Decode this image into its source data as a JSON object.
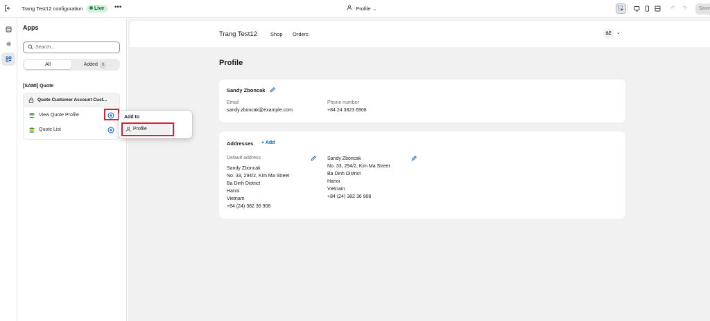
{
  "topbar": {
    "title": "Trang Test12 configuration",
    "status": "Live",
    "more": "•••",
    "page_selector": "Profile",
    "save": "Save"
  },
  "apps_panel": {
    "title": "Apps",
    "search_placeholder": "Search...",
    "tabs": {
      "all": "All",
      "added": "Added",
      "added_count": "0"
    },
    "group_title": "[SAMI] Quote",
    "app_header": "Quote Customer Account Cust...",
    "blocks": [
      {
        "label": "View Quote Profile"
      },
      {
        "label": "Quote List"
      }
    ]
  },
  "popover": {
    "title": "Add to",
    "item": "Profile"
  },
  "preview": {
    "store_name": "Trang Test12",
    "nav": {
      "shop": "Shop",
      "orders": "Orders"
    },
    "avatar": "SZ",
    "page_title": "Profile",
    "customer": {
      "name": "Sandy Zboncak",
      "email_label": "Email",
      "email": "sandy.zboncak@example.com",
      "phone_label": "Phone number",
      "phone": "+84 24 3823 6908"
    },
    "addresses": {
      "title": "Addresses",
      "add": "+ Add",
      "default_label": "Default address",
      "default": {
        "name": "Sandy Zboncak",
        "line1": "No. 33, 294/2, Kim Ma Street",
        "line2": "Ba Dinh District",
        "city": "Hanoi",
        "country": "Vietnam",
        "phone": "+84 (24) 382 36 908"
      },
      "second": {
        "name": "Sandy Zboncak",
        "line1": "No. 33, 294/2, Kim Ma Street",
        "line2": "Ba Dinh District",
        "city": "Hanoi",
        "country": "Vietnam",
        "phone": "+84 (24) 382 36 908"
      }
    }
  },
  "colors": {
    "highlight": "#e01b3c",
    "link": "#005bd3",
    "live_bg": "#cdf2d8"
  }
}
